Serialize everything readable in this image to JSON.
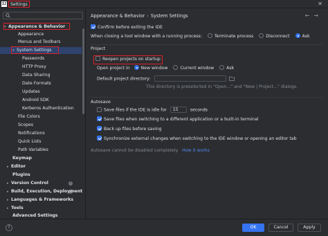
{
  "window": {
    "title": "Settings",
    "app_icon_text": "IJ",
    "close_glyph": "✕"
  },
  "sidebar": {
    "items": [
      {
        "label": "Appearance & Behavior",
        "chevron": "▾"
      },
      {
        "label": "Appearance"
      },
      {
        "label": "Menus and Toolbars"
      },
      {
        "label": "System Settings",
        "chevron": "▾"
      },
      {
        "label": "Passwords"
      },
      {
        "label": "HTTP Proxy"
      },
      {
        "label": "Data Sharing"
      },
      {
        "label": "Date Formats"
      },
      {
        "label": "Updates"
      },
      {
        "label": "Android SDK"
      },
      {
        "label": "Kerberos Authentication"
      },
      {
        "label": "File Colors"
      },
      {
        "label": "Scopes"
      },
      {
        "label": "Notifications"
      },
      {
        "label": "Quick Lists"
      },
      {
        "label": "Path Variables"
      },
      {
        "label": "Keymap"
      },
      {
        "label": "Editor",
        "chevron": "▸"
      },
      {
        "label": "Plugins"
      },
      {
        "label": "Version Control",
        "chevron": "▸"
      },
      {
        "label": "Build, Execution, Deployment",
        "chevron": "▸"
      },
      {
        "label": "Languages & Frameworks",
        "chevron": "▸"
      },
      {
        "label": "Tools",
        "chevron": "▸"
      },
      {
        "label": "Advanced Settings"
      }
    ],
    "badge_glyph": "i"
  },
  "header": {
    "breadcrumb_parent": "Appearance & Behavior",
    "breadcrumb_sep": "›",
    "breadcrumb_current": "System Settings",
    "nav_back": "←",
    "nav_forward": "→"
  },
  "general": {
    "confirm_exit_label": "Confirm before exiting the IDE",
    "confirm_exit_checked": true,
    "closing_tool_window_label": "When closing a tool window with a running process:",
    "closing_options": [
      "Terminate process",
      "Disconnect",
      "Ask"
    ],
    "closing_selected": "Ask"
  },
  "project": {
    "section_title": "Project",
    "reopen_label": "Reopen projects on startup",
    "reopen_checked": false,
    "open_in_label": "Open project in",
    "open_options": [
      "New window",
      "Current window",
      "Ask"
    ],
    "open_selected": "New window",
    "default_dir_label": "Default project directory:",
    "default_dir_value": "",
    "default_dir_hint": "This directory is preselected in \"Open...\" and \"New | Project...\" dialogs."
  },
  "autosave": {
    "section_title": "Autosave",
    "idle_label_pre": "Save files if the IDE is idle for",
    "idle_value": "15",
    "idle_label_post": "seconds",
    "idle_checked": false,
    "switch_label": "Save files when switching to a different application or a built-in terminal",
    "switch_checked": true,
    "backup_label": "Back up files before saving",
    "backup_checked": true,
    "sync_label": "Synchronize external changes when switching to the IDE window or opening an editor tab",
    "sync_checked": true,
    "note": "Autosave cannot be disabled completely.",
    "link": "How it works"
  },
  "footer": {
    "help": "?",
    "ok": "OK",
    "cancel": "Cancel",
    "apply": "Apply"
  },
  "colors": {
    "accent": "#3574f0",
    "highlight_box": "#e0202c",
    "selection": "#2e436e",
    "background": "#2b2d30"
  }
}
